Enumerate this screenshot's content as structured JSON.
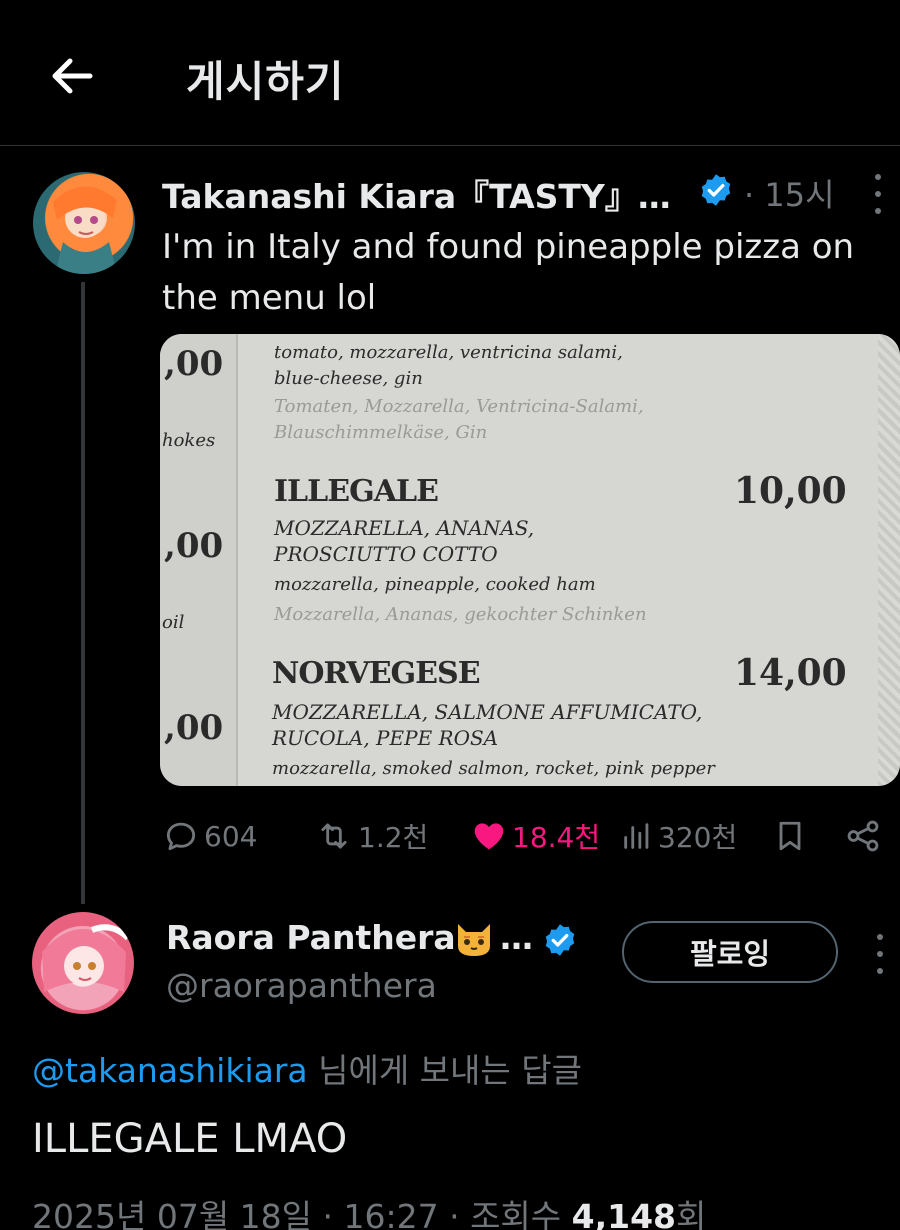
{
  "header": {
    "title": "게시하기",
    "back_icon": "arrow-left-icon"
  },
  "original_post": {
    "author_name": "Takanashi Kiara『TASTY』…",
    "verified": true,
    "time": "· 15시",
    "text": "I'm in Italy and found pineapple pizza on the menu lol",
    "media": {
      "left_column": {
        "price1": ",00",
        "word1": "hokes",
        "price2": ",00",
        "word2": "oil",
        "price3": ",00"
      },
      "top_item": {
        "line1": "tomato, mozzarella, ventricina salami,",
        "line2": "blue-cheese, gin",
        "line3": "Tomaten, Mozzarella, Ventricina-Salami,",
        "line4": "Blauschimmelkäse, Gin"
      },
      "item1": {
        "name": "ILLEGALE",
        "price": "10,00",
        "caps1": "MOZZARELLA, ANANAS,",
        "caps2": "PROSCIUTTO COTTO",
        "english": "mozzarella, pineapple, cooked ham",
        "german": "Mozzarella, Ananas, gekochter Schinken"
      },
      "item2": {
        "name": "NORVEGESE",
        "price": "14,00",
        "caps1": "MOZZARELLA, SALMONE AFFUMICATO,",
        "caps2": "RUCOLA, PEPE ROSA",
        "english": "mozzarella, smoked salmon, rocket, pink pepper"
      }
    },
    "actions": {
      "replies": "604",
      "reposts": "1.2천",
      "likes": "18.4천",
      "views": "320천"
    },
    "colors": {
      "like": "#f91880",
      "verified": "#1d9bf0"
    }
  },
  "reply_post": {
    "author_name": "Raora Panthera",
    "name_ellipsis": "…",
    "emoji": "cat-face",
    "verified": true,
    "handle": "@raorapanthera",
    "follow_label": "팔로잉",
    "reply_to_mention": "@takanashikiara",
    "reply_to_suffix": " 님에게 보내는 답글",
    "text": "ILLEGALE LMAO",
    "date": "2025년 07월 18일 · 16:27 · 조회수 ",
    "view_count": "4,148",
    "view_unit": "회"
  }
}
